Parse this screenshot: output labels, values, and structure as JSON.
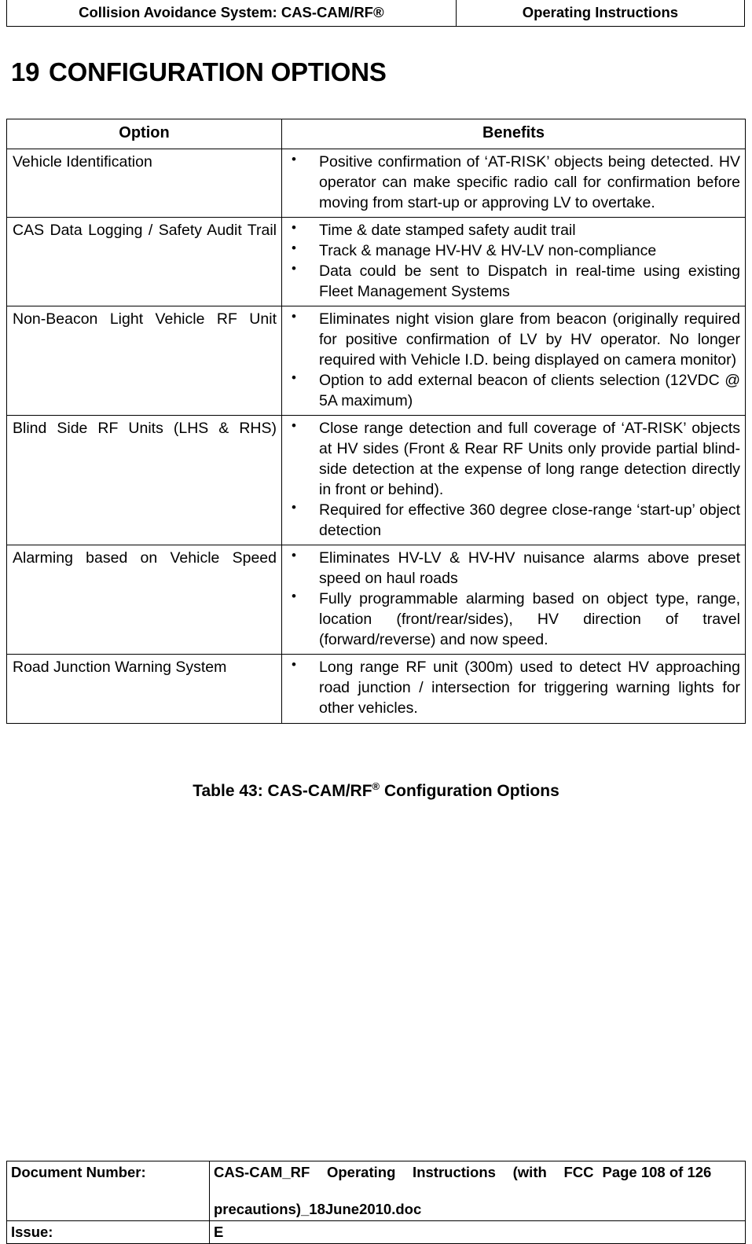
{
  "header": {
    "left_title": "Collision Avoidance System: CAS-CAM/RF®",
    "right_title": "Operating Instructions"
  },
  "heading": {
    "number": "19",
    "text": "CONFIGURATION OPTIONS"
  },
  "table": {
    "columns": {
      "option": "Option",
      "benefits": "Benefits"
    },
    "rows": [
      {
        "option": "Vehicle Identification",
        "benefits": [
          "Positive confirmation of ‘AT-RISK’ objects being detected. HV operator can make specific radio call for confirmation before moving from start-up or approving LV to overtake."
        ]
      },
      {
        "option": "CAS Data Logging / Safety Audit Trail",
        "benefits": [
          "Time & date stamped safety audit trail",
          "Track & manage HV-HV & HV-LV non-compliance",
          "Data could be sent to Dispatch in real-time using existing Fleet Management Systems"
        ]
      },
      {
        "option": "Non-Beacon Light Vehicle RF Unit",
        "benefits": [
          "Eliminates night vision glare from beacon (originally required for positive confirmation of LV by HV operator. No longer required with Vehicle I.D. being displayed on camera monitor)",
          "Option to add external beacon of clients selection (12VDC @ 5A maximum)"
        ]
      },
      {
        "option": "Blind Side RF Units (LHS & RHS)",
        "benefits": [
          "Close range detection and full coverage of ‘AT-RISK’ objects at HV sides (Front & Rear RF Units only provide partial blind-side detection at the expense of long range detection directly in front or behind).",
          "Required for effective 360 degree close-range ‘start-up’ object detection"
        ]
      },
      {
        "option": "Alarming based on Vehicle Speed",
        "benefits": [
          "Eliminates HV-LV & HV-HV nuisance alarms above preset speed on haul roads",
          "Fully programmable alarming based on object type, range, location (front/rear/sides), HV direction of travel (forward/reverse) and now speed."
        ]
      },
      {
        "option": "Road Junction Warning System",
        "benefits": [
          "Long range RF unit (300m) used to detect HV approaching road junction / intersection for triggering warning lights for other vehicles."
        ]
      }
    ]
  },
  "caption": {
    "prefix": "Table 43:  CAS-CAM/RF",
    "superscript": "®",
    "suffix": " Configuration Options"
  },
  "footer": {
    "doc_number_label": "Document Number:",
    "doc_number_value_line1": "CAS-CAM_RF Operating Instructions (with FCC",
    "doc_number_value_line2": "precautions)_18June2010.doc",
    "page_text": "Page 108 of  126",
    "issue_label": "Issue:",
    "issue_value": "E"
  }
}
